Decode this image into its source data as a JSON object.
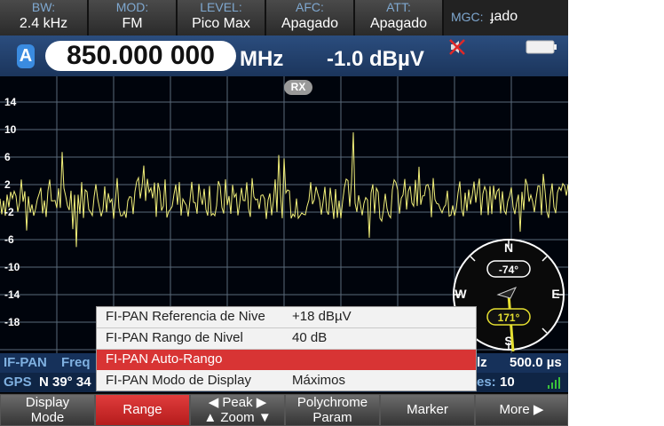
{
  "top_bar": {
    "cells": [
      {
        "label": "BW:",
        "value": "2.4 kHz"
      },
      {
        "label": "MOD:",
        "value": "FM"
      },
      {
        "label": "LEVEL:",
        "value": "Pico Max"
      },
      {
        "label": "AFC:",
        "value": "Apagado"
      },
      {
        "label": "ATT:",
        "value": "Apagado"
      }
    ],
    "mgc_label": "MGC:",
    "mgc_value": "ɟado"
  },
  "freq_row": {
    "receiver_badge": "A",
    "frequency": "850.000 000",
    "unit": "MHz",
    "level": "-1.0 dBµV"
  },
  "spectrum": {
    "rx_badge": "RX",
    "y_labels": [
      "14",
      "10",
      "6",
      "2",
      "-2",
      "-6",
      "-10",
      "-14",
      "-18"
    ],
    "y_range": [
      -22,
      18
    ],
    "trace_color": "#f2f07a",
    "grid_color": "#5a6a7a"
  },
  "compass": {
    "north": "N",
    "south": "S",
    "east": "E",
    "west": "W",
    "bearing_top": "-74°",
    "bearing_bottom": "171°"
  },
  "popup_menu": {
    "items": [
      {
        "label": "FI-PAN Referencia de Nive",
        "value": "+18 dBµV",
        "selected": false
      },
      {
        "label": "FI-PAN Rango de Nivel",
        "value": "40 dB",
        "selected": false
      },
      {
        "label": "FI-PAN Auto-Rango",
        "value": "",
        "selected": true
      },
      {
        "label": "FI-PAN Modo de Display",
        "value": "Máximos",
        "selected": false
      }
    ]
  },
  "status": {
    "ifpan_label": "IF-PAN",
    "ifpan_freq_label": "Freq",
    "ifpan_right_fragment": "lz",
    "ifpan_time": "500.0 µs",
    "gps_label": "GPS",
    "gps_value": "N 39° 34",
    "gps_right_label": "es:",
    "gps_right_value": "10"
  },
  "softkeys": [
    {
      "line1": "Display",
      "line2": "Mode",
      "active": false
    },
    {
      "line1": "Range",
      "line2": "",
      "active": true
    },
    {
      "line1": "◀ Peak ▶",
      "line2": "▲ Zoom ▼",
      "active": false
    },
    {
      "line1": "Polychrome",
      "line2": "Param",
      "active": false
    },
    {
      "line1": "Marker",
      "line2": "",
      "active": false
    },
    {
      "line1": "More ▶",
      "line2": "",
      "active": false
    }
  ],
  "colors": {
    "accent_blue": "#2b4d7e",
    "active_red": "#d83434",
    "label_blue": "#7fa8d0"
  }
}
